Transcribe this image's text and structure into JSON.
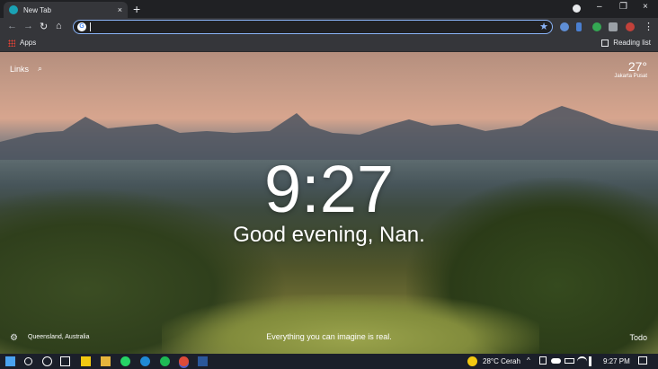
{
  "browser": {
    "tab_title": "New Tab",
    "tab_close": "×",
    "new_tab": "+",
    "window_buttons": [
      "–",
      "❐",
      "×"
    ],
    "bookmarks": {
      "apps_label": "Apps",
      "reading_list_label": "Reading list"
    }
  },
  "dashboard": {
    "links_label": "Links",
    "weather": {
      "temperature": "27°",
      "location": "Jakarta Pusat"
    },
    "time": "9:27",
    "greeting": "Good evening, Nan.",
    "photo_location": "Queensland, Australia",
    "quote": "Everything you can imagine is real.",
    "todo_label": "Todo"
  },
  "taskbar": {
    "weather_text": "28°C  Cerah",
    "time": "9:27 PM"
  },
  "icons": {
    "search": "⌕",
    "star": "★",
    "gear": "⚙",
    "back": "←",
    "forward": "→",
    "reload": "↻",
    "home": "⌂",
    "menu": "⋮"
  },
  "colors": {
    "omnibox_border": "#8ab4f8",
    "tab_bg": "#35363a",
    "frame_bg": "#202124",
    "taskbar_bg": "#1b1f2a"
  }
}
